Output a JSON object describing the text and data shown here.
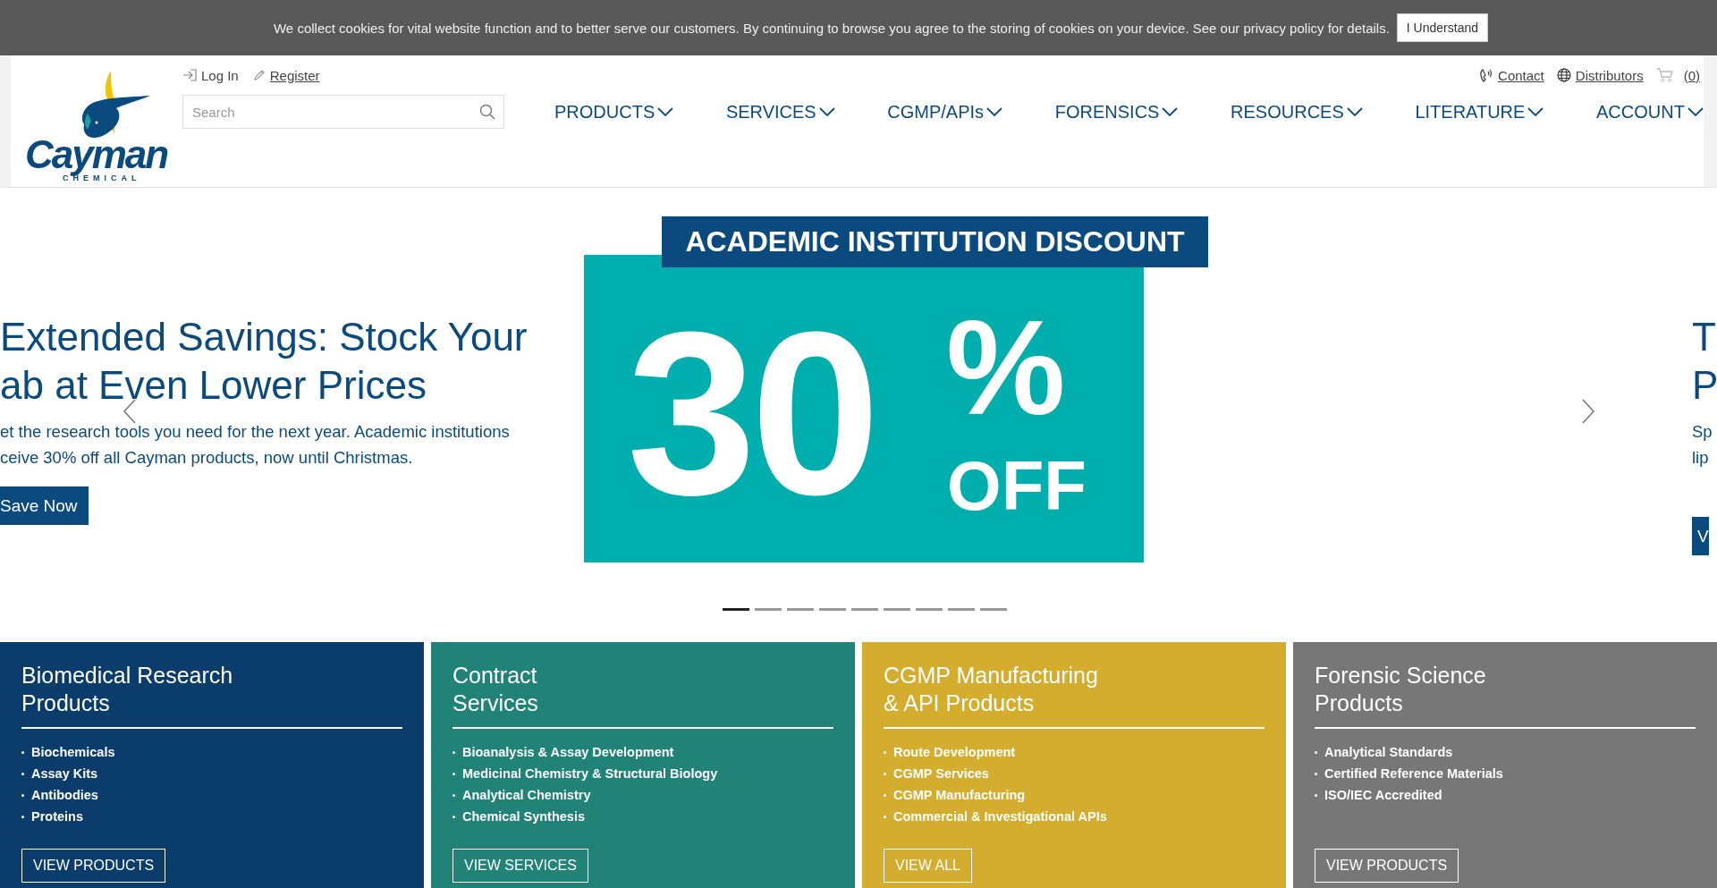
{
  "cookie_bar": {
    "message": "We collect cookies for vital website function and to better serve our customers. By continuing to browse you agree to the storing of cookies on your device. See our privacy policy for details.",
    "button": "I Understand"
  },
  "header": {
    "logo": {
      "wordmark": "Cayman",
      "tagline": "CHEMICAL"
    },
    "account_links": [
      {
        "kind": "login",
        "label": "Log In"
      },
      {
        "kind": "register",
        "label": "Register"
      }
    ],
    "search": {
      "placeholder": "Search"
    },
    "utility_links": [
      {
        "kind": "phone",
        "label": "Contact"
      },
      {
        "kind": "globe",
        "label": "Distributors"
      },
      {
        "kind": "cart",
        "label": "(0)"
      }
    ],
    "nav": [
      "PRODUCTS",
      "SERVICES",
      "CGMP/APIs",
      "FORENSICS",
      "RESOURCES",
      "LITERATURE",
      "ACCOUNT"
    ]
  },
  "hero": {
    "previous_slide": {
      "headline_lines": [
        "Extended Savings: Stock Your",
        "ab at Even Lower Prices"
      ],
      "body_lines": [
        "et the research tools you need for the next year. Academic institutions",
        "ceive 30% off all Cayman products, now until Christmas."
      ],
      "button": "Save Now"
    },
    "banner": {
      "label": "ACADEMIC INSTITUTION DISCOUNT",
      "number": "30",
      "percent": "%",
      "off": "OFF"
    },
    "next_slide": {
      "headline_lines": [
        "T",
        "P"
      ],
      "body_lines": [
        "Sp",
        "lip"
      ],
      "button": "V"
    },
    "pager": [
      {
        "selected": true
      },
      {
        "selected": false
      },
      {
        "selected": false
      },
      {
        "selected": false
      },
      {
        "selected": false
      },
      {
        "selected": false
      },
      {
        "selected": false
      },
      {
        "selected": false
      },
      {
        "selected": false
      }
    ]
  },
  "cards": [
    {
      "title_lines": [
        "Biomedical Research",
        "Products"
      ],
      "color": "#0a3d6b",
      "items": [
        "Biochemicals",
        "Assay Kits",
        "Antibodies",
        "Proteins"
      ],
      "button": "VIEW PRODUCTS"
    },
    {
      "title_lines": [
        "Contract",
        "Services"
      ],
      "color": "#218277",
      "items": [
        "Bioanalysis & Assay Development",
        "Medicinal Chemistry & Structural Biology",
        "Analytical Chemistry",
        "Chemical Synthesis"
      ],
      "button": "VIEW SERVICES"
    },
    {
      "title_lines": [
        "CGMP Manufacturing",
        "& API Products"
      ],
      "color": "#d4ad2f",
      "items": [
        "Route Development",
        "CGMP Services",
        "CGMP Manufacturing",
        "Commercial & Investigational APIs"
      ],
      "button": "VIEW ALL"
    },
    {
      "title_lines": [
        "Forensic Science",
        "Products"
      ],
      "color": "#777777",
      "items": [
        "Analytical Standards",
        "Certified Reference Materials",
        "ISO/IEC Accredited"
      ],
      "button": "VIEW PRODUCTS"
    }
  ]
}
